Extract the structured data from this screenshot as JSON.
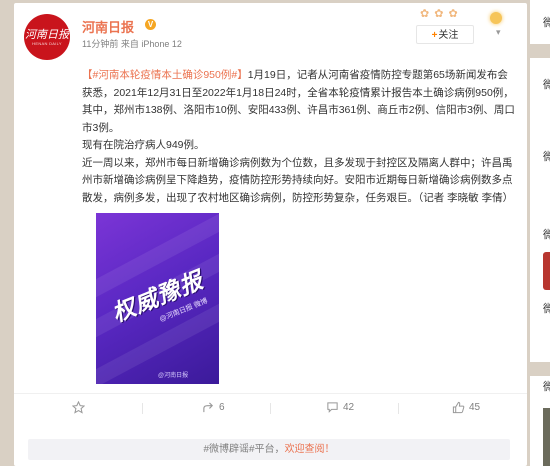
{
  "post": {
    "avatar_text": "河南日报",
    "avatar_subtext": "HENAN DAILY",
    "author": "河南日报",
    "meta": "11分钟前 来自 iPhone 12",
    "follow_label": "关注",
    "paragraphs": [
      {
        "tag": "【#河南本轮疫情本土确诊950例#】",
        "text": "1月19日，记者从河南省疫情防控专题第65场新闻发布会获悉，2021年12月31日至2022年1月18日24时，全省本轮疫情累计报告本土确诊病例950例，其中，郑州市138例、洛阳市10例、安阳433例、许昌市361例、商丘市2例、信阳市3例、周口市3例。"
      },
      {
        "tag": "",
        "text": "现有在院治疗病人949例。"
      },
      {
        "tag": "",
        "text": "近一周以来，郑州市每日新增确诊病例数为个位数，且多发现于封控区及隔离人群中；许昌禹州市新增确诊病例呈下降趋势，疫情防控形势持续向好。安阳市近期每日新增确诊病例数多点散发，病例多发，出现了农村地区确诊病例，防控形势复杂，任务艰巨。（记者 李晓敏 李倩）"
      }
    ],
    "image": {
      "title": "权威豫报",
      "subtitle": "@河南日报 微博",
      "watermark": "@河南日报"
    }
  },
  "actions": {
    "forward_count": "6",
    "comment_count": "42",
    "like_count": "45"
  },
  "comment_box": {
    "prefix": "#微博辟谣#平台，",
    "link": "欢迎查阅！"
  },
  "sidebar": {
    "labels": [
      "微",
      "微",
      "微",
      "微",
      "微",
      "微"
    ]
  },
  "colors": {
    "accent": "#eb7350",
    "follow_plus": "#ff8200",
    "brand_red": "#c9141c",
    "image_purple": "#6a2fd0"
  }
}
